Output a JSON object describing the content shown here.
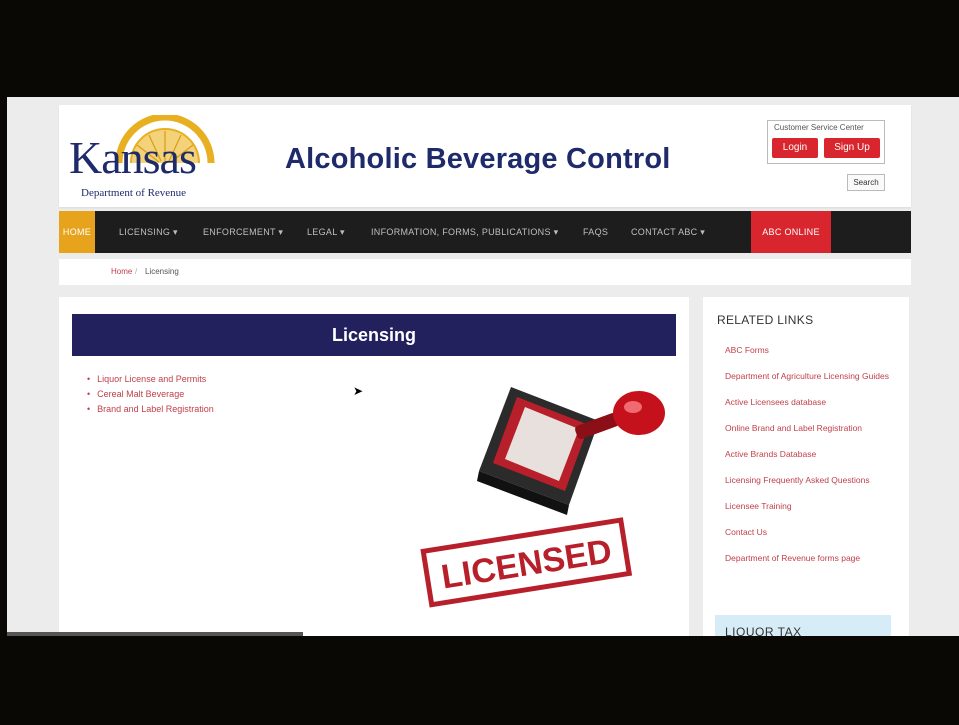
{
  "header": {
    "logo_text": "Kansas",
    "logo_subtitle": "Department of Revenue",
    "title": "Alcoholic Beverage Control",
    "customer_service_label": "Customer Service Center",
    "login_label": "Login",
    "signup_label": "Sign Up",
    "search_label": "Search"
  },
  "nav": {
    "items": [
      {
        "label": "HOME"
      },
      {
        "label": "LICENSING ▾"
      },
      {
        "label": "ENFORCEMENT ▾"
      },
      {
        "label": "LEGAL ▾"
      },
      {
        "label": "INFORMATION, FORMS, PUBLICATIONS ▾"
      },
      {
        "label": "FAQS"
      },
      {
        "label": "CONTACT ABC ▾"
      },
      {
        "label": "ABC ONLINE"
      }
    ]
  },
  "breadcrumb": {
    "home": "Home",
    "separator": "/",
    "current": "Licensing"
  },
  "main": {
    "banner": "Licensing",
    "links": [
      "Liquor License and Permits",
      "Cereal Malt Beverage",
      "Brand and Label Registration"
    ],
    "stamp_text": "LICENSED"
  },
  "sidebar": {
    "title": "RELATED LINKS",
    "links": [
      "ABC Forms",
      "Department of Agriculture Licensing Guides",
      "Active Licensees database",
      "Online Brand and Label Registration",
      "Active Brands Database",
      "Licensing Frequently Asked Questions",
      "Licensee Training",
      "Contact Us",
      "Department of Revenue forms page"
    ],
    "box_title": "LIQUOR TAX"
  },
  "colors": {
    "navy": "#23205e",
    "accent_red": "#d9262e",
    "home_gold": "#e8a31d",
    "link_red": "#c0404b"
  }
}
